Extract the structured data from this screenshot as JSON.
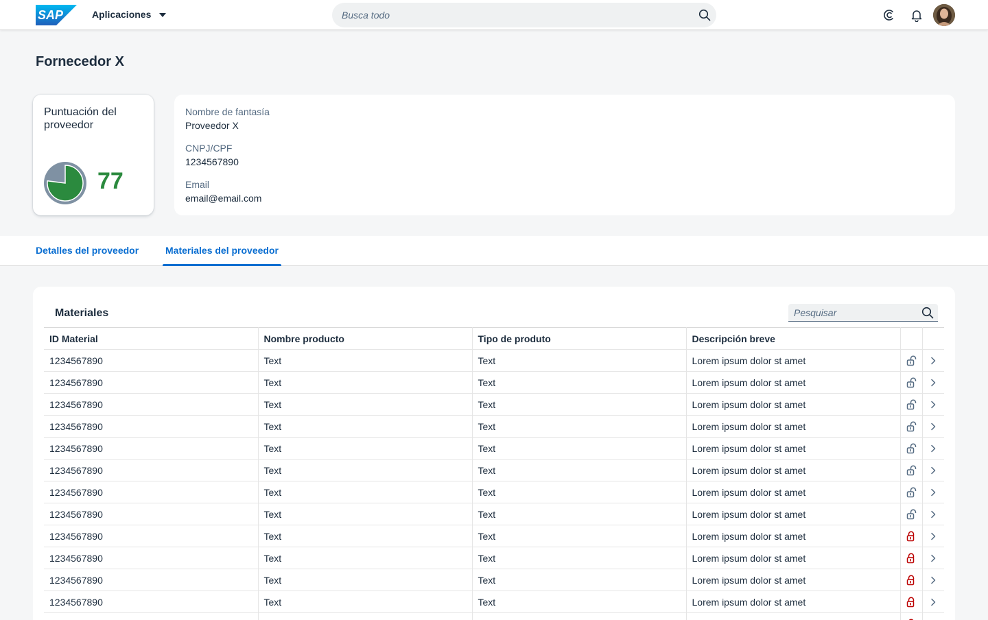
{
  "shell": {
    "apps_label": "Aplicaciones",
    "search_placeholder": "Busca todo"
  },
  "page": {
    "title": "Fornecedor X"
  },
  "score": {
    "label": "Puntuación del proveedor",
    "value": "77",
    "fraction": 0.77
  },
  "info": {
    "fields": [
      {
        "label": "Nombre de fantasía",
        "value": "Proveedor X"
      },
      {
        "label": "CNPJ/CPF",
        "value": "1234567890"
      },
      {
        "label": "Email",
        "value": "email@email.com"
      }
    ]
  },
  "tabs": [
    {
      "label": "Detalles del proveedor",
      "active": false
    },
    {
      "label": "Materiales del proveedor",
      "active": true
    }
  ],
  "materials": {
    "title": "Materiales",
    "search_placeholder": "Pesquisar",
    "columns": [
      "ID Material",
      "Nombre producto",
      "Tipo de produto",
      "Descripción breve"
    ],
    "rows": [
      {
        "id": "1234567890",
        "name": "Text",
        "type": "Text",
        "desc": "Lorem ipsum dolor st amet",
        "lock": "unlock-icon"
      },
      {
        "id": "1234567890",
        "name": "Text",
        "type": "Text",
        "desc": "Lorem ipsum dolor st amet",
        "lock": "unlock-icon"
      },
      {
        "id": "1234567890",
        "name": "Text",
        "type": "Text",
        "desc": "Lorem ipsum dolor st amet",
        "lock": "unlock-icon"
      },
      {
        "id": "1234567890",
        "name": "Text",
        "type": "Text",
        "desc": "Lorem ipsum dolor st amet",
        "lock": "unlock-icon"
      },
      {
        "id": "1234567890",
        "name": "Text",
        "type": "Text",
        "desc": "Lorem ipsum dolor st amet",
        "lock": "unlock-icon"
      },
      {
        "id": "1234567890",
        "name": "Text",
        "type": "Text",
        "desc": "Lorem ipsum dolor st amet",
        "lock": "unlock-icon"
      },
      {
        "id": "1234567890",
        "name": "Text",
        "type": "Text",
        "desc": "Lorem ipsum dolor st amet",
        "lock": "unlock-icon"
      },
      {
        "id": "1234567890",
        "name": "Text",
        "type": "Text",
        "desc": "Lorem ipsum dolor st amet",
        "lock": "unlock-icon"
      },
      {
        "id": "1234567890",
        "name": "Text",
        "type": "Text",
        "desc": "Lorem ipsum dolor st amet",
        "lock": "lock-icon"
      },
      {
        "id": "1234567890",
        "name": "Text",
        "type": "Text",
        "desc": "Lorem ipsum dolor st amet",
        "lock": "lock-icon"
      },
      {
        "id": "1234567890",
        "name": "Text",
        "type": "Text",
        "desc": "Lorem ipsum dolor st amet",
        "lock": "lock-icon"
      },
      {
        "id": "1234567890",
        "name": "Text",
        "type": "Text",
        "desc": "Lorem ipsum dolor st amet",
        "lock": "lock-icon"
      },
      {
        "id": "",
        "name": "",
        "type": "",
        "desc": "",
        "lock": "lock-icon"
      }
    ]
  },
  "colors": {
    "accent": "#0a6ed1",
    "score_positive": "#2b8a3e",
    "score_remaining": "#7f91a3",
    "locked": "#bb0000",
    "unlocked": "#556b82"
  },
  "icons": [
    "sap-logo",
    "search-icon",
    "copilot-icon",
    "bell-icon",
    "avatar",
    "unlock-icon",
    "lock-icon",
    "chevron-right-icon"
  ]
}
